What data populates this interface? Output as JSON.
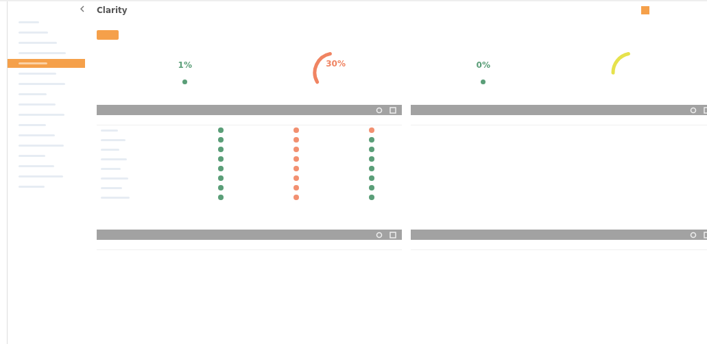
{
  "title": "Clarity",
  "sidebar": {
    "items": [
      {
        "selected": false
      },
      {
        "selected": false
      },
      {
        "selected": false
      },
      {
        "selected": false
      },
      {
        "selected": true
      },
      {
        "selected": false
      },
      {
        "selected": false
      },
      {
        "selected": false
      },
      {
        "selected": false
      },
      {
        "selected": false
      },
      {
        "selected": false
      },
      {
        "selected": false
      },
      {
        "selected": false
      },
      {
        "selected": false
      },
      {
        "selected": false
      },
      {
        "selected": false
      },
      {
        "selected": false
      }
    ]
  },
  "gauges": [
    {
      "kind": "dot",
      "value": "1%",
      "color": "#5a9e78"
    },
    {
      "kind": "arc",
      "value": "30%",
      "color": "#f08462",
      "level": 0.3
    },
    {
      "kind": "dot",
      "value": "0%",
      "color": "#5a9e78"
    },
    {
      "kind": "arc",
      "color": "#e6e24c",
      "level": 0.22
    }
  ],
  "panels": [
    {
      "kind": "status_table",
      "rows": [
        {
          "dots": [
            {
              "color": "#5a9e78"
            },
            {
              "color": "#f29070"
            },
            {
              "color": "#f29070"
            }
          ]
        },
        {
          "dots": [
            {
              "color": "#5a9e78"
            },
            {
              "color": "#f29070"
            },
            {
              "color": "#5a9e78"
            }
          ]
        },
        {
          "dots": [
            {
              "color": "#5a9e78"
            },
            {
              "color": "#f29070"
            },
            {
              "color": "#5a9e78"
            }
          ]
        },
        {
          "dots": [
            {
              "color": "#5a9e78"
            },
            {
              "color": "#f29070"
            },
            {
              "color": "#5a9e78"
            }
          ]
        },
        {
          "dots": [
            {
              "color": "#5a9e78"
            },
            {
              "color": "#f29070"
            },
            {
              "color": "#5a9e78"
            }
          ]
        },
        {
          "dots": [
            {
              "color": "#5a9e78"
            },
            {
              "color": "#f29070"
            },
            {
              "color": "#5a9e78"
            }
          ]
        },
        {
          "dots": [
            {
              "color": "#5a9e78"
            },
            {
              "color": "#f29070"
            },
            {
              "color": "#5a9e78"
            }
          ]
        },
        {
          "dots": [
            {
              "color": "#5a9e78"
            },
            {
              "color": "#f29070"
            },
            {
              "color": "#5a9e78"
            }
          ]
        }
      ]
    },
    {
      "kind": "list"
    },
    {
      "kind": "list"
    },
    {
      "kind": "list"
    }
  ]
}
